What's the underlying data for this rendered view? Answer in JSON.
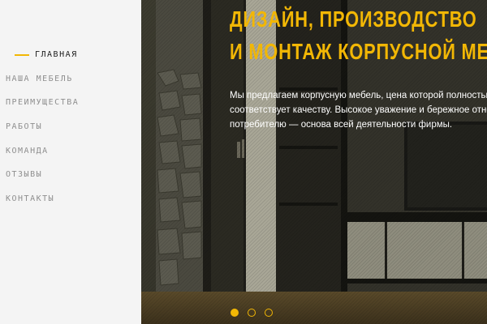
{
  "nav": {
    "items": [
      {
        "label": "ГЛАВНАЯ",
        "active": true
      },
      {
        "label": "НАША МЕБЕЛЬ",
        "active": false
      },
      {
        "label": "ПРЕИМУЩЕСТВА",
        "active": false
      },
      {
        "label": "РАБОТЫ",
        "active": false
      },
      {
        "label": "КОМАНДА",
        "active": false
      },
      {
        "label": "ОТЗЫВЫ",
        "active": false
      },
      {
        "label": "КОНТАКТЫ",
        "active": false
      }
    ]
  },
  "hero": {
    "title_line1": "ДИЗАЙН, ПРОИЗВОДСТВО",
    "title_line2": "И МОНТАЖ КОРПУСНОЙ МЕБЕЛИ",
    "desc_line1": "Мы предлагаем корпусную мебель, цена которой полностью",
    "desc_line2": "соответствует качеству. Высокое уважение и бережное отношение к",
    "desc_line3": "потребителю — основа всей деятельности фирмы.",
    "slides": {
      "count": 3,
      "active": 0
    }
  },
  "colors": {
    "accent": "#f2b705",
    "sidebar_bg": "#f4f4f4",
    "nav_text": "#8f8f8f",
    "nav_active": "#1e1e1e"
  },
  "icons": {
    "active_marker": "dash-line",
    "slider_dot": "circle"
  }
}
